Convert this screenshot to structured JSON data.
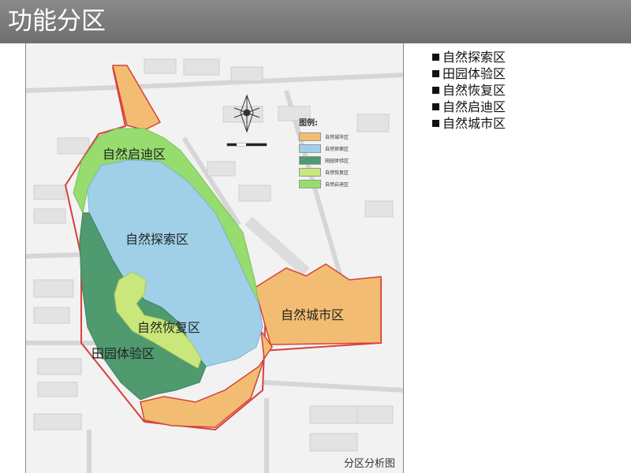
{
  "header": {
    "title": "功能分区"
  },
  "map": {
    "caption": "分区分析图",
    "legend": {
      "title": "图例:",
      "items": [
        {
          "label": "自然城市区",
          "color": "#f2bd73"
        },
        {
          "label": "自然探索区",
          "color": "#9fd0e8"
        },
        {
          "label": "田园体验区",
          "color": "#4f9a6e"
        },
        {
          "label": "自然恢复区",
          "color": "#c9e77a"
        },
        {
          "label": "自然启迪区",
          "color": "#96dc6e"
        }
      ]
    },
    "zones": {
      "qidi": "自然启迪区",
      "tansuo": "自然探索区",
      "huifu": "自然恢复区",
      "tianyuan": "田园体验区",
      "chengshi": "自然城市区"
    }
  },
  "side_list": [
    "自然探索区",
    "田园体验区",
    "自然恢复区",
    "自然启迪区",
    "自然城市区"
  ]
}
